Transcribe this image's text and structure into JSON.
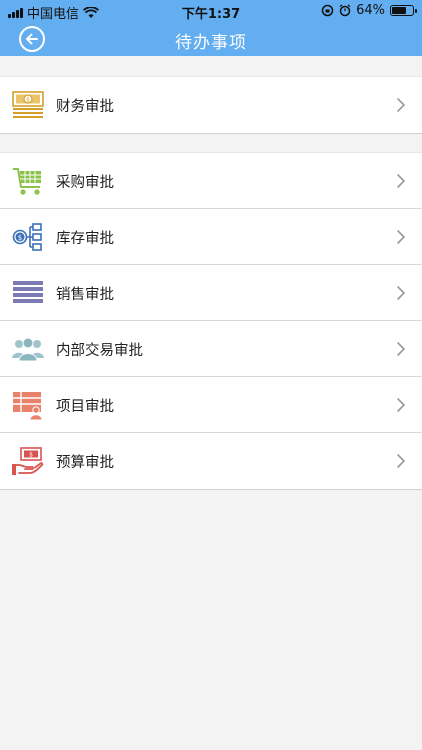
{
  "status_bar": {
    "carrier": "中国电信",
    "time": "下午1:37",
    "battery": "64%"
  },
  "header": {
    "title": "待办事项"
  },
  "groups": [
    {
      "items": [
        {
          "label": "财务审批",
          "icon": "money-stack-icon"
        }
      ]
    },
    {
      "items": [
        {
          "label": "采购审批",
          "icon": "shopping-cart-icon"
        },
        {
          "label": "库存审批",
          "icon": "inventory-tree-icon"
        },
        {
          "label": "销售审批",
          "icon": "stripes-list-icon"
        },
        {
          "label": "内部交易审批",
          "icon": "people-group-icon"
        },
        {
          "label": "项目审批",
          "icon": "project-board-icon"
        },
        {
          "label": "预算审批",
          "icon": "hand-money-icon"
        }
      ]
    }
  ],
  "colors": {
    "header_bg": "#63aef0",
    "finance_icon": "#d4a02a",
    "purchase_icon": "#8cc14a",
    "inventory_icon": "#3b6fb6",
    "sales_icon": "#7b7bb3",
    "internal_icon": "#9fc4cc",
    "project_icon": "#e8826b",
    "budget_icon": "#d9534f"
  }
}
